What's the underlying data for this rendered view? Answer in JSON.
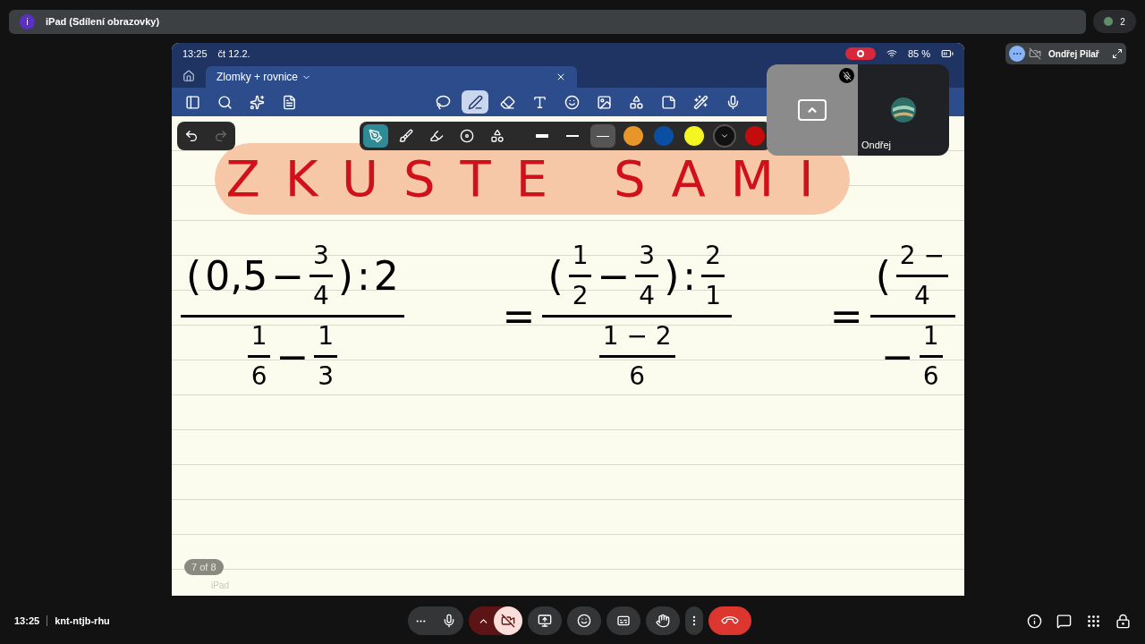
{
  "meet_top_bar": {
    "badge": "i",
    "title": "iPad (Sdílení obrazovky)",
    "participants_count": "2"
  },
  "ipad": {
    "status_bar": {
      "time": "13:25",
      "date": "čt 12.2.",
      "recording": true,
      "battery": "85 %"
    },
    "tab": {
      "title": "Zlomky + rovnice"
    },
    "toolbar_tools": [
      {
        "kind": "sidebar",
        "selected": false
      },
      {
        "kind": "search",
        "selected": false
      },
      {
        "kind": "sparkle",
        "selected": false
      },
      {
        "kind": "doc",
        "selected": false
      },
      {
        "kind": "lasso",
        "selected": false
      },
      {
        "kind": "pen",
        "selected": true
      },
      {
        "kind": "eraser",
        "selected": false
      },
      {
        "kind": "textbox",
        "selected": false
      },
      {
        "kind": "sticker",
        "selected": false
      },
      {
        "kind": "image",
        "selected": false
      },
      {
        "kind": "shapes",
        "selected": false
      },
      {
        "kind": "note",
        "selected": false
      },
      {
        "kind": "laser",
        "selected": false
      },
      {
        "kind": "mic",
        "selected": false
      }
    ],
    "pen_tools": [
      {
        "kind": "fountain",
        "selected": true
      },
      {
        "kind": "brush",
        "selected": false
      },
      {
        "kind": "highlighter",
        "selected": false
      },
      {
        "kind": "spiral",
        "selected": false
      },
      {
        "kind": "shapes",
        "selected": false
      }
    ],
    "thickness": [
      {
        "kind": "thick",
        "selected": false
      },
      {
        "kind": "medium",
        "selected": false
      },
      {
        "kind": "thin",
        "selected": true
      }
    ],
    "colors": [
      {
        "color": "#e8952a",
        "selected": false
      },
      {
        "color": "#0b4fa3",
        "selected": false
      },
      {
        "color": "#f5f520",
        "selected": false
      },
      {
        "color": "#111111",
        "selected": true
      },
      {
        "color": "#c40c0c",
        "selected": false
      }
    ],
    "heading": "ZKUSTE SAMI",
    "expressions": [
      {
        "numerator": [
          {
            "kind": "text",
            "text": "("
          },
          {
            "kind": "text",
            "text": "0,5"
          },
          {
            "kind": "text",
            "text": "−"
          },
          {
            "kind": "frac",
            "num": "3",
            "den": "4"
          },
          {
            "kind": "text",
            "text": ")"
          },
          {
            "kind": "text",
            "text": ":"
          },
          {
            "kind": "text",
            "text": "2"
          }
        ],
        "denominator": [
          {
            "kind": "frac",
            "num": "1",
            "den": "6"
          },
          {
            "kind": "text",
            "text": "−"
          },
          {
            "kind": "frac",
            "num": "1",
            "den": "3"
          }
        ]
      },
      {
        "equals_sign": "=",
        "numerator": [
          {
            "kind": "text",
            "text": "("
          },
          {
            "kind": "frac",
            "num": "1",
            "den": "2"
          },
          {
            "kind": "text",
            "text": "−"
          },
          {
            "kind": "frac",
            "num": "3",
            "den": "4"
          },
          {
            "kind": "text",
            "text": ")"
          },
          {
            "kind": "text",
            "text": ":"
          },
          {
            "kind": "frac",
            "num": "2",
            "den": "1"
          }
        ],
        "denominator": [
          {
            "kind": "frac",
            "num": "1 − 2",
            "den": "6"
          }
        ]
      },
      {
        "equals_sign": "=",
        "numerator": [
          {
            "kind": "text",
            "text": "("
          },
          {
            "kind": "frac",
            "num": "2 −",
            "den": "4"
          }
        ],
        "denominator": [
          {
            "kind": "text",
            "text": "−"
          },
          {
            "kind": "frac",
            "num": "1",
            "den": "6"
          }
        ]
      }
    ],
    "page_indicator": "7 of 8",
    "footer_label": "iPad",
    "self_view": {
      "name": "Ondřej",
      "muted": true
    }
  },
  "pinned_tile": {
    "name": "Ondřej Pilař",
    "camera_on": false
  },
  "bottom_bar": {
    "time": "13:25",
    "meeting_code": "knt-ntjb-rhu",
    "mic_on": true,
    "camera_on": false
  }
}
